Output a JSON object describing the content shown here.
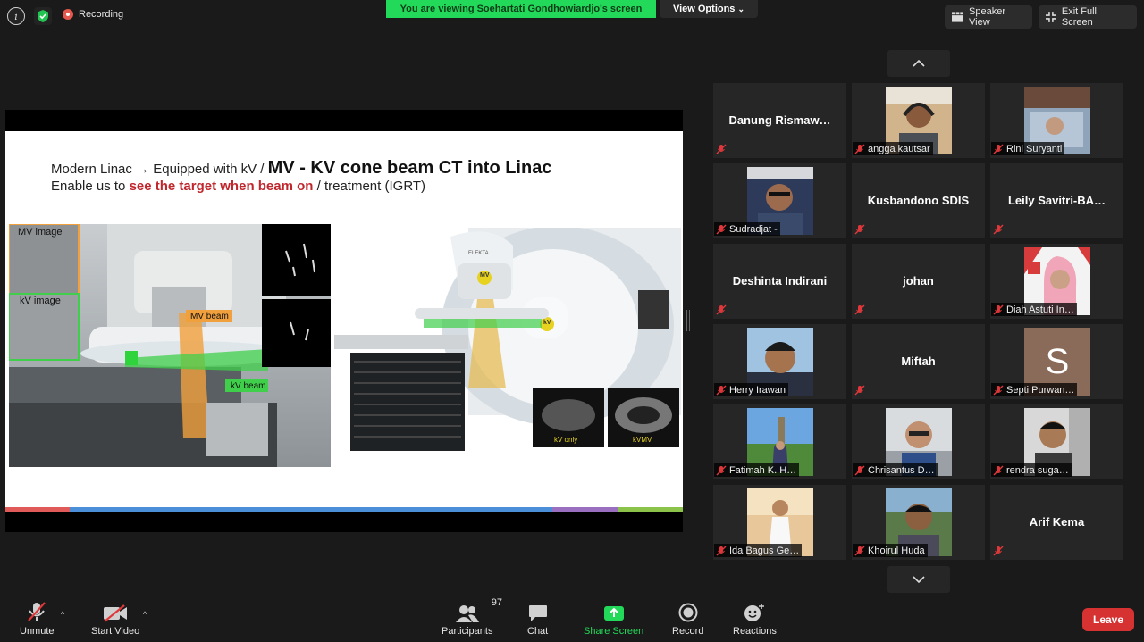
{
  "top": {
    "recording": "Recording",
    "banner": "You are viewing Soehartati Gondhowiardjo's screen",
    "view_options": "View Options",
    "speaker_view": "Speaker View",
    "exit_full_screen": "Exit Full Screen"
  },
  "slide": {
    "line1_prefix": "Modern Linac → Equipped with kV / ",
    "line1_big": "MV - KV cone beam CT into Linac",
    "line2_prefix": "Enable us to ",
    "line2_red": "see the target when beam on",
    "line2_suffix": " / treatment (IGRT)",
    "labels": {
      "mv_image": "MV image",
      "kv_image": "kV image",
      "mv_beam": "MV beam",
      "kv_beam": "kV beam",
      "kv_only": "kV only",
      "kvmv": "kVMV",
      "mv_badge": "MV",
      "kv_badge": "kV",
      "brand": "ELEKTA"
    }
  },
  "participants": [
    {
      "name": "Danung  Rismaw…"
    },
    {
      "name": "angga kautsar"
    },
    {
      "name": "Rini Suryanti"
    },
    {
      "name": "Sudradjat -"
    },
    {
      "name": "Kusbandono SDIS"
    },
    {
      "name": "Leily  Savitri-BA…"
    },
    {
      "name": "Deshinta Indirani"
    },
    {
      "name": "johan"
    },
    {
      "name": "Diah Astuti In…"
    },
    {
      "name": "Herry Irawan"
    },
    {
      "name": "Miftah"
    },
    {
      "name": "Septi Purwan…",
      "avatar_letter": "S"
    },
    {
      "name": "Fatimah K. H…"
    },
    {
      "name": "Chrisantus D…"
    },
    {
      "name": "rendra suga…"
    },
    {
      "name": "Ida Bagus Ge…"
    },
    {
      "name": "Khoirul Huda"
    },
    {
      "name": "Arif Kema"
    }
  ],
  "toolbar": {
    "unmute": "Unmute",
    "start_video": "Start Video",
    "participants_label": "Participants",
    "participants_count": "97",
    "chat": "Chat",
    "share_screen": "Share Screen",
    "record": "Record",
    "reactions": "Reactions",
    "leave": "Leave"
  },
  "colors": {
    "accent_green": "#23d959",
    "leave_red": "#d73232",
    "muted_red": "#e0383a",
    "slide_red": "#c0272d"
  }
}
